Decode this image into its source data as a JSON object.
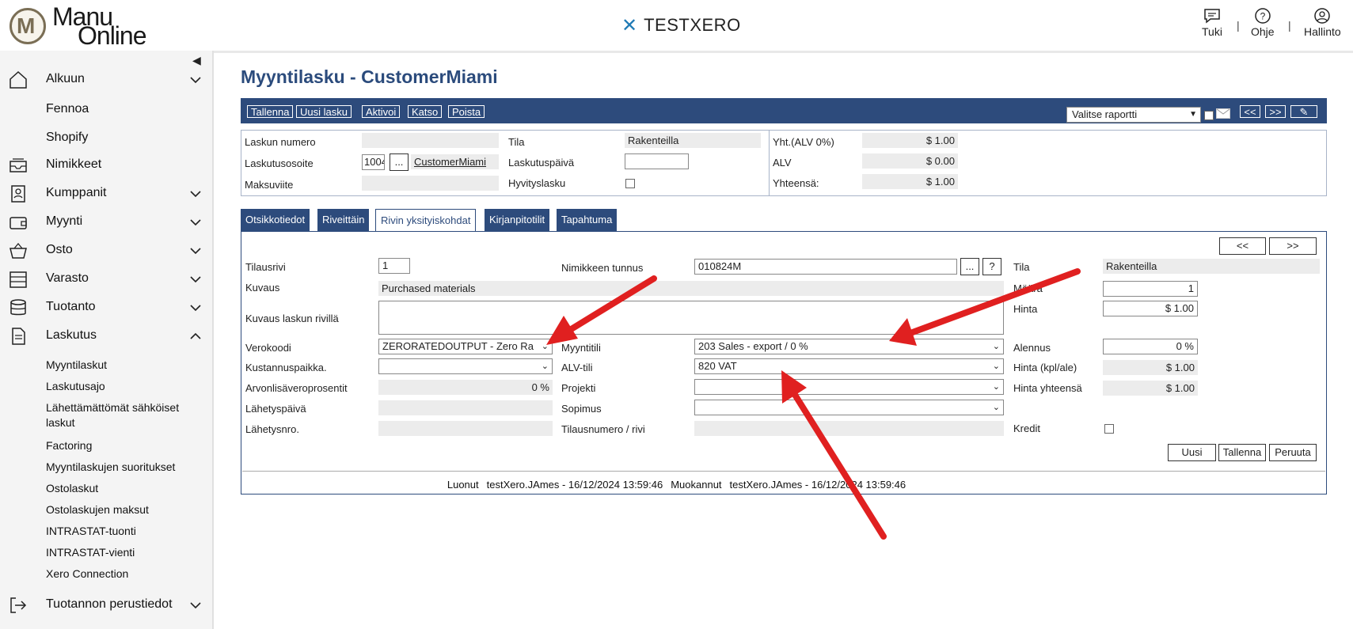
{
  "header": {
    "logo_line1": "Manu",
    "logo_line2": "Online",
    "logo_mark": "M",
    "brand": "TESTXERO",
    "actions": [
      {
        "label": "Tuki",
        "icon": "chat-icon"
      },
      {
        "label": "Ohje",
        "icon": "help-icon"
      },
      {
        "label": "Hallinto",
        "icon": "user-icon"
      }
    ],
    "separator": "|"
  },
  "sidebar": {
    "items": [
      {
        "label": "Alkuun",
        "icon": "home-icon",
        "expandable": true
      },
      {
        "label": "Fennoa"
      },
      {
        "label": "Shopify"
      },
      {
        "label": "Nimikkeet",
        "icon": "inbox-icon"
      },
      {
        "label": "Kumppanit",
        "icon": "contacts-icon",
        "expandable": true
      },
      {
        "label": "Myynti",
        "icon": "wallet-icon",
        "expandable": true
      },
      {
        "label": "Osto",
        "icon": "basket-icon",
        "expandable": true
      },
      {
        "label": "Varasto",
        "icon": "warehouse-icon",
        "expandable": true
      },
      {
        "label": "Tuotanto",
        "icon": "database-icon",
        "expandable": true
      },
      {
        "label": "Laskutus",
        "icon": "document-icon",
        "expanded": true
      }
    ],
    "laskutus_sub": [
      "Myyntilaskut",
      "Laskutusajo",
      "Lähettämättömät sähköiset laskut",
      "Factoring",
      "Myyntilaskujen suoritukset",
      "Ostolaskut",
      "Ostolaskujen maksut",
      "INTRASTAT-tuonti",
      "INTRASTAT-vienti",
      "Xero Connection"
    ],
    "bottom_item": {
      "label": "Tuotannon perustiedot",
      "icon": "logout-icon"
    }
  },
  "page": {
    "title": "Myyntilasku - CustomerMiami",
    "toolbar_buttons": [
      "Tallenna",
      "Uusi lasku",
      "Aktivoi",
      "Katso",
      "Poista"
    ],
    "report_select": "Valitse raportti",
    "nav_prev": "<<",
    "nav_next": ">>"
  },
  "invoice_header": {
    "laskun_numero_label": "Laskun numero",
    "laskun_numero": "",
    "laskutusosoite_label": "Laskutusosoite",
    "laskutusosoite_code": "1004",
    "browse_label": "...",
    "customer_link": "CustomerMiami",
    "maksuviite_label": "Maksuviite",
    "maksuviite": "",
    "tila_label": "Tila",
    "tila": "Rakenteilla",
    "laskutuspaiva_label": "Laskutuspäivä",
    "laskutuspaiva": "",
    "hyvityslasku_label": "Hyvityslasku",
    "yht_label": "Yht.(ALV 0%)",
    "yht": "$ 1.00",
    "alv_label": "ALV",
    "alv": "$ 0.00",
    "yhteensa_label": "Yhteensä:",
    "yhteensa": "$ 1.00"
  },
  "tabs": [
    {
      "label": "Otsikkotiedot",
      "active": false
    },
    {
      "label": "Riveittäin",
      "active": false
    },
    {
      "label": "Rivin yksityiskohdat",
      "active": true
    },
    {
      "label": "Kirjanpitotilit",
      "active": false
    },
    {
      "label": "Tapahtuma",
      "active": false
    }
  ],
  "row_detail": {
    "prev": "<<",
    "next": ">>",
    "tilausrivi_label": "Tilausrivi",
    "tilausrivi": "1",
    "kuvaus_label": "Kuvaus",
    "kuvaus": "Purchased materials",
    "kuvaus_rivilla_label": "Kuvaus laskun rivillä",
    "kuvaus_rivilla": "",
    "verokoodi_label": "Verokoodi",
    "verokoodi": "ZERORATEDOUTPUT - Zero Ra",
    "kustannuspaikka_label": "Kustannuspaikka.",
    "kustannuspaikka": "",
    "alv_prosentti_label": "Arvonlisäveroprosentit",
    "alv_prosentti": "0 %",
    "lahetyspaiva_label": "Lähetyspäivä",
    "lahetyspaiva": "",
    "lahetysnro_label": "Lähetysnro.",
    "lahetysnro": "",
    "nimikkeen_tunnus_label": "Nimikkeen tunnus",
    "nimikkeen_tunnus": "010824M",
    "browse_label": "...",
    "help_label": "?",
    "myyntitili_label": "Myyntitili",
    "myyntitili": "203 Sales - export / 0 %",
    "alv_tili_label": "ALV-tili",
    "alv_tili": "820 VAT",
    "projekti_label": "Projekti",
    "projekti": "",
    "sopimus_label": "Sopimus",
    "sopimus": "",
    "tilausnumero_label": "Tilausnumero / rivi",
    "tilausnumero": "",
    "tila_label": "Tila",
    "tila": "Rakenteilla",
    "maara_label": "Määrä",
    "maara": "1",
    "hinta_label": "Hinta",
    "hinta": "$ 1.00",
    "alennus_label": "Alennus",
    "alennus": "0 %",
    "hinta_kpl_label": "Hinta (kpl/ale)",
    "hinta_kpl": "$ 1.00",
    "hinta_yht_label": "Hinta yhteensä",
    "hinta_yht": "$ 1.00",
    "kredit_label": "Kredit",
    "buttons": [
      "Uusi",
      "Tallenna",
      "Peruuta"
    ]
  },
  "footer": {
    "created_label": "Luonut",
    "created": "testXero.JAmes - 16/12/2024 13:59:46",
    "modified_label": "Muokannut",
    "modified": "testXero.JAmes - 16/12/2024 13:59:46"
  },
  "colors": {
    "primary": "#2d4b7c",
    "arrow": "#e02020",
    "readonly_bg": "#ececec"
  }
}
